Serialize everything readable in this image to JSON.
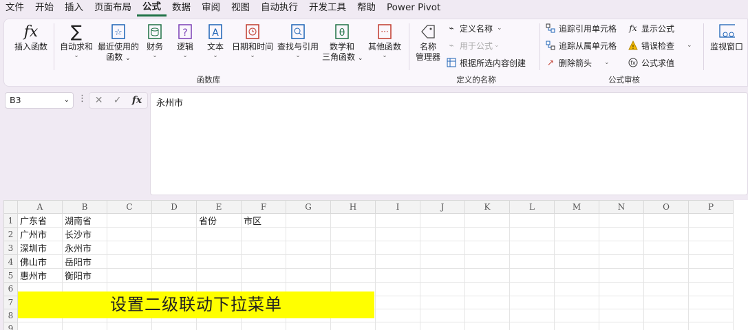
{
  "menu": [
    "文件",
    "开始",
    "插入",
    "页面布局",
    "公式",
    "数据",
    "审阅",
    "视图",
    "自动执行",
    "开发工具",
    "帮助",
    "Power Pivot"
  ],
  "active_menu": "公式",
  "ribbon": {
    "insert_function": "插入函数",
    "autosum": "自动求和",
    "recent": [
      "最近使用的",
      "函数"
    ],
    "finance": "财务",
    "logic": "逻辑",
    "text": "文本",
    "datetime": "日期和时间",
    "lookup": "查找与引用",
    "math": [
      "数学和",
      "三角函数"
    ],
    "other": "其他函数",
    "group_library": "函数库",
    "name_manager": [
      "名称",
      "管理器"
    ],
    "define_name": "定义名称",
    "use_in_formula": "用于公式",
    "create_from_selection": "根据所选内容创建",
    "group_names": "定义的名称",
    "trace_precedents": "追踪引用单元格",
    "trace_dependents": "追踪从属单元格",
    "remove_arrows": "删除箭头",
    "show_formulas": "显示公式",
    "error_checking": "错误检查",
    "evaluate_formula": "公式求值",
    "group_audit": "公式审核",
    "watch_window": "监视窗口",
    "chev": "⌄"
  },
  "formula_bar": {
    "name_box": "B3",
    "dots": "⋮",
    "cancel": "✕",
    "confirm": "✓",
    "fx": "fx",
    "content": "永州市"
  },
  "columns": [
    "A",
    "B",
    "C",
    "D",
    "E",
    "F",
    "G",
    "H",
    "I",
    "J",
    "K",
    "L",
    "M",
    "N",
    "O",
    "P"
  ],
  "rows": [
    {
      "n": "1",
      "cells": {
        "A": "广东省",
        "B": "湖南省",
        "E": "省份",
        "F": "市区"
      }
    },
    {
      "n": "2",
      "cells": {
        "A": "广州市",
        "B": "长沙市"
      }
    },
    {
      "n": "3",
      "cells": {
        "A": "深圳市",
        "B": "永州市"
      }
    },
    {
      "n": "4",
      "cells": {
        "A": "佛山市",
        "B": "岳阳市"
      }
    },
    {
      "n": "5",
      "cells": {
        "A": "惠州市",
        "B": "衡阳市"
      }
    },
    {
      "n": "6",
      "cells": {}
    },
    {
      "n": "7",
      "cells": {}
    },
    {
      "n": "8",
      "cells": {}
    },
    {
      "n": "9",
      "cells": {}
    }
  ],
  "banner_text": "设置二级联动下拉菜单",
  "colors": {
    "accent": "#1e7145",
    "banner": "#ffff00"
  }
}
